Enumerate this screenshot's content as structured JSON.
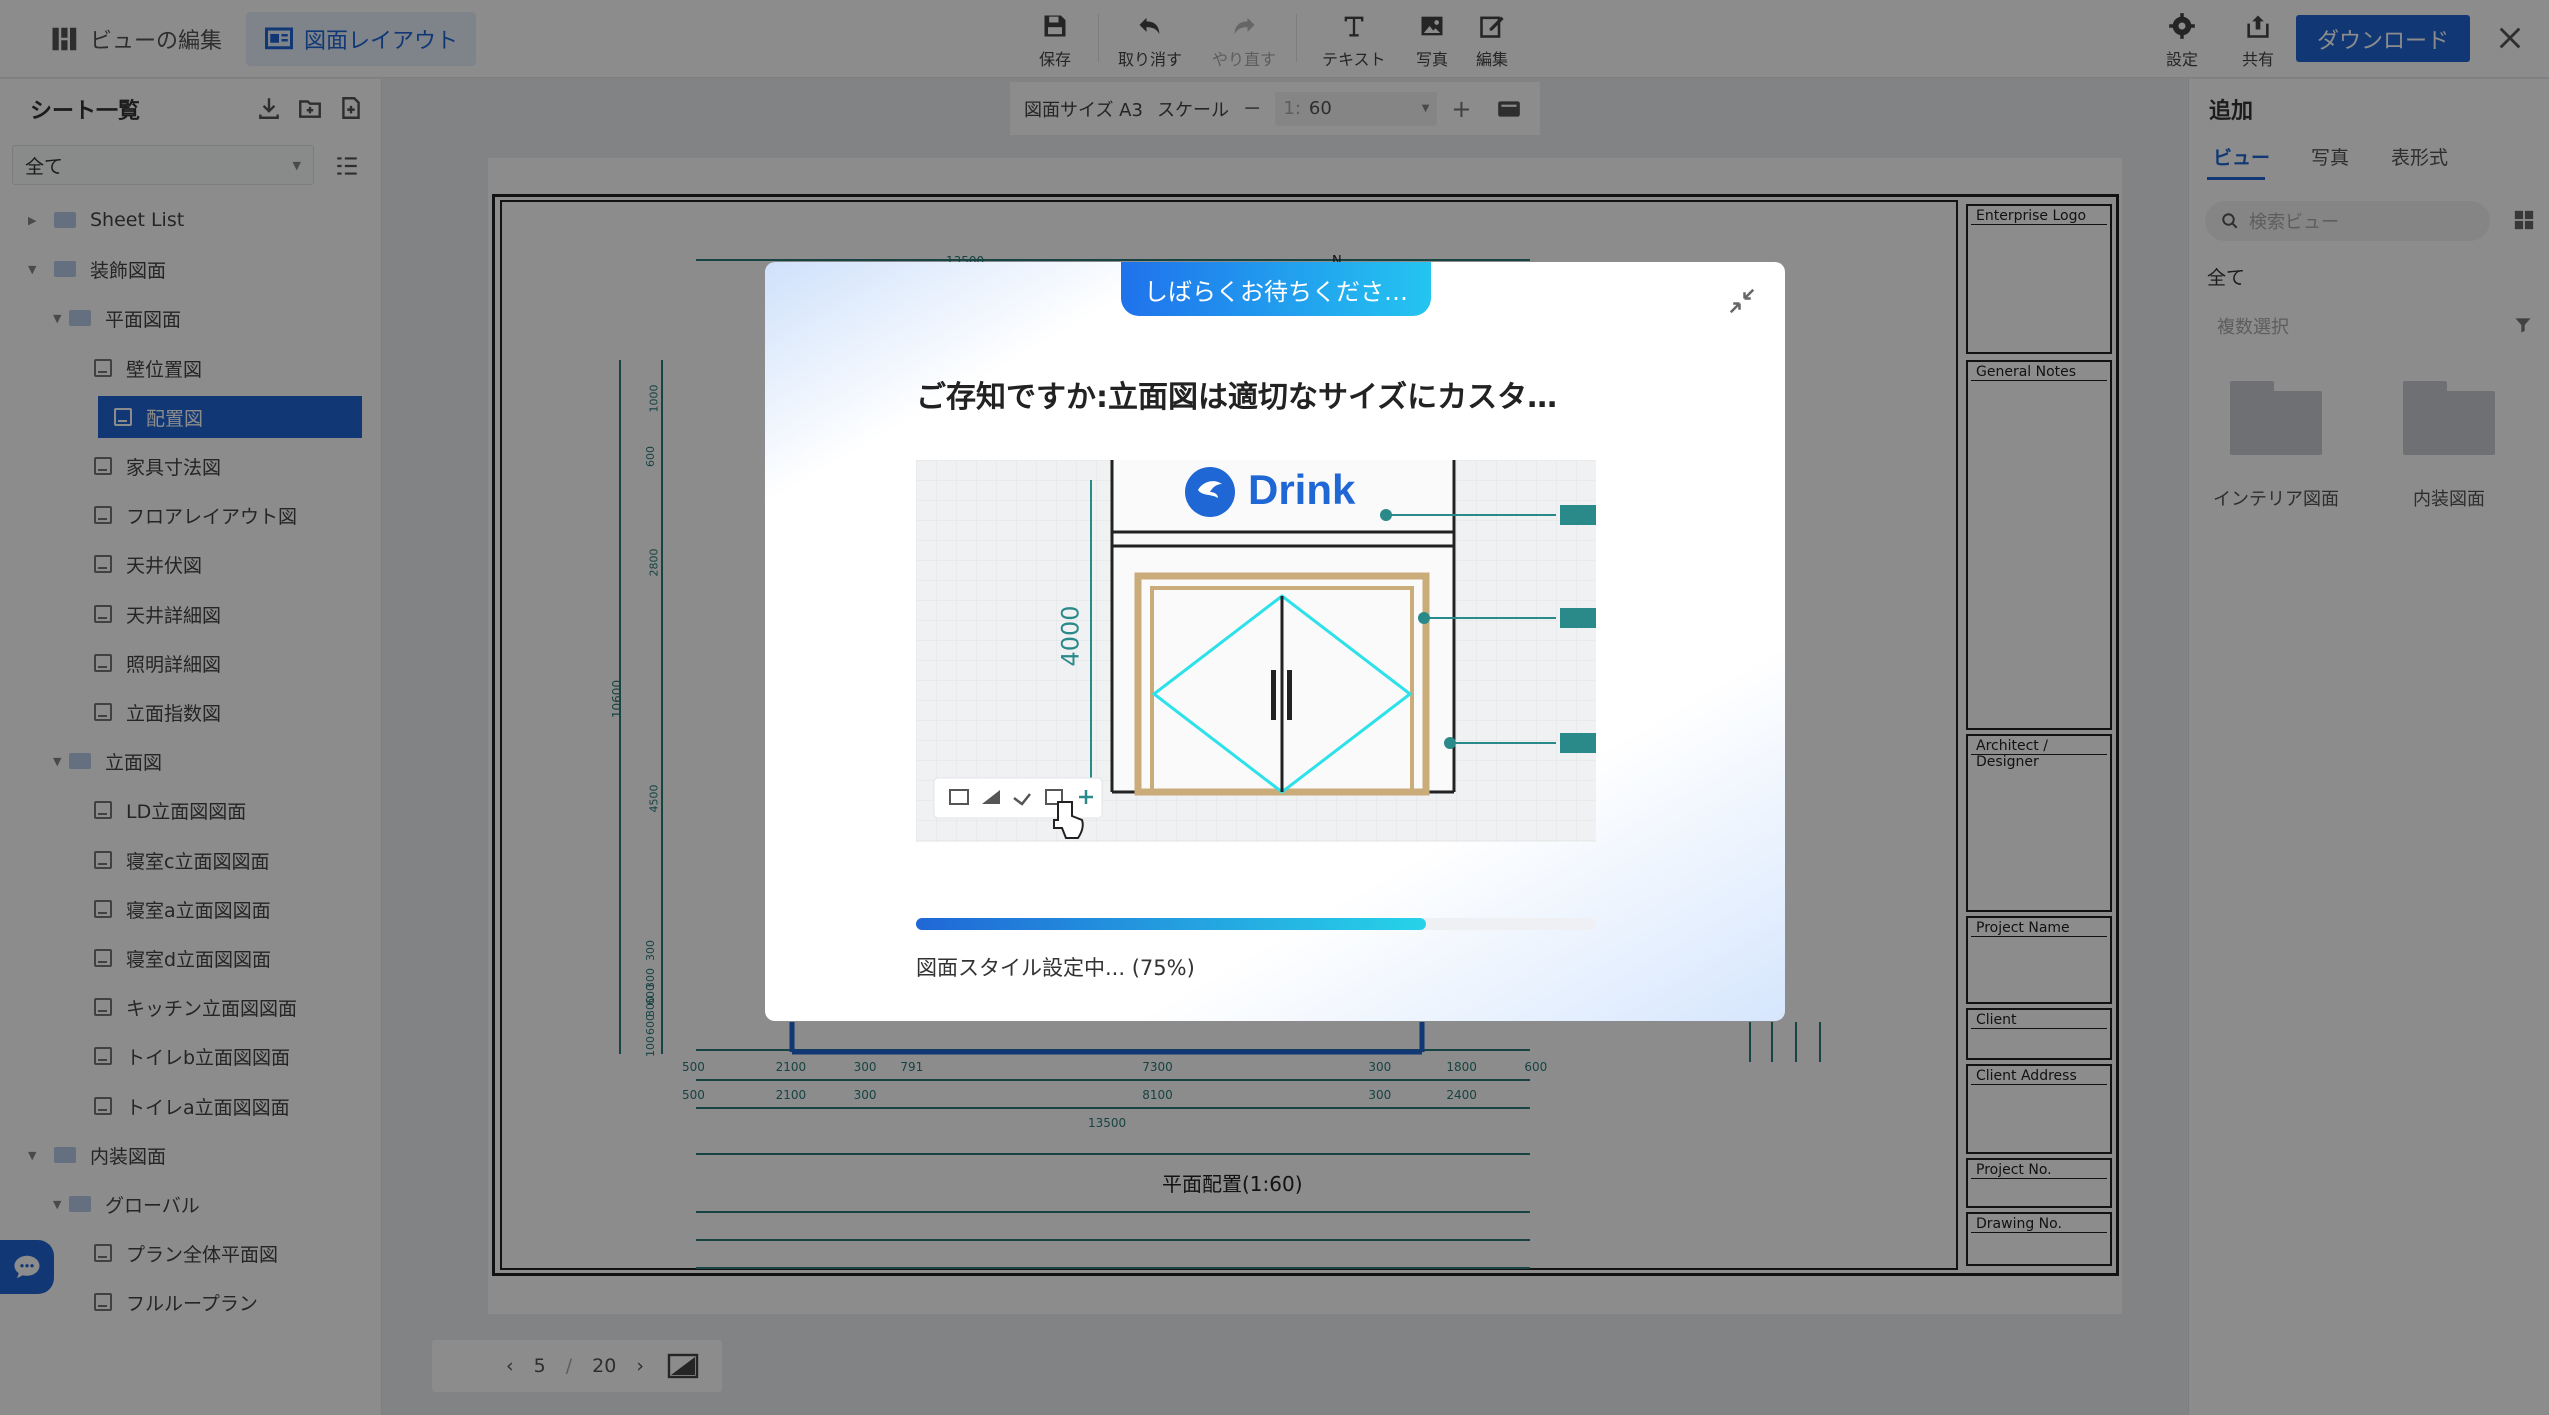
{
  "modes": {
    "view_edit": "ビューの編集",
    "layout": "図面レイアウト"
  },
  "toolbar": {
    "save": "保存",
    "undo": "取り消す",
    "redo": "やり直す",
    "text": "テキスト",
    "photo": "写真",
    "edit": "編集",
    "settings": "設定",
    "share": "共有",
    "download": "ダウンロード"
  },
  "sidebar": {
    "title": "シート一覧",
    "filter": "全て",
    "tree": [
      {
        "label": "Sheet List",
        "kind": "folder",
        "level": 0,
        "expanded": false
      },
      {
        "label": "装飾図面",
        "kind": "folder",
        "level": 0,
        "expanded": true
      },
      {
        "label": "平面図面",
        "kind": "folder",
        "level": 1,
        "expanded": true
      },
      {
        "label": "壁位置図",
        "kind": "sheet",
        "level": 2
      },
      {
        "label": "配置図",
        "kind": "sheet",
        "level": 2,
        "selected": true
      },
      {
        "label": "家具寸法図",
        "kind": "sheet",
        "level": 2
      },
      {
        "label": "フロアレイアウト図",
        "kind": "sheet",
        "level": 2
      },
      {
        "label": "天井伏図",
        "kind": "sheet",
        "level": 2
      },
      {
        "label": "天井詳細図",
        "kind": "sheet",
        "level": 2
      },
      {
        "label": "照明詳細図",
        "kind": "sheet",
        "level": 2
      },
      {
        "label": "立面指数図",
        "kind": "sheet",
        "level": 2
      },
      {
        "label": "立面図",
        "kind": "folder",
        "level": 1,
        "expanded": true
      },
      {
        "label": "LD立面図図面",
        "kind": "sheet",
        "level": 2
      },
      {
        "label": "寝室c立面図図面",
        "kind": "sheet",
        "level": 2
      },
      {
        "label": "寝室a立面図図面",
        "kind": "sheet",
        "level": 2
      },
      {
        "label": "寝室d立面図図面",
        "kind": "sheet",
        "level": 2
      },
      {
        "label": "キッチン立面図図面",
        "kind": "sheet",
        "level": 2
      },
      {
        "label": "トイレb立面図図面",
        "kind": "sheet",
        "level": 2
      },
      {
        "label": "トイレa立面図図面",
        "kind": "sheet",
        "level": 2
      },
      {
        "label": "内装図面",
        "kind": "folder",
        "level": 0,
        "expanded": true
      },
      {
        "label": "グローバル",
        "kind": "folder",
        "level": 1,
        "expanded": true
      },
      {
        "label": "プラン全体平面図",
        "kind": "sheet",
        "level": 2
      },
      {
        "label": "フルループラン",
        "kind": "sheet",
        "level": 2
      }
    ]
  },
  "scalebar": {
    "size_label": "図面サイズ A3",
    "scale_label": "スケール",
    "scale_prefix": "1:",
    "scale_value": "60"
  },
  "sheet": {
    "caption": "平面配置(1:60)",
    "north": "N",
    "top_dim": "13500",
    "left_dims": [
      "1000",
      "600",
      "2800",
      "4500",
      "300",
      "300",
      "600",
      "300",
      "600",
      "100"
    ],
    "left_total": "10600",
    "bottom_row1": [
      "500",
      "2100",
      "300",
      "791",
      "7300",
      "300",
      "1800",
      "600"
    ],
    "bottom_row2": [
      "500",
      "2100",
      "300",
      "8100",
      "300",
      "2400"
    ],
    "bottom_total": "13500",
    "titleblock": [
      "Enterprise Logo",
      "General Notes",
      "Architect / Designer",
      "Project Name",
      "Client",
      "Client Address",
      "Project No.",
      "Drawing No."
    ]
  },
  "rightpanel": {
    "title": "追加",
    "tabs": [
      "ビュー",
      "写真",
      "表形式"
    ],
    "search_placeholder": "検索ビュー",
    "filter_all": "全て",
    "multi_select": "複数選択",
    "folders": [
      "インテリア図面",
      "内装図面"
    ]
  },
  "pager": {
    "current": "5",
    "sep": "/",
    "total": "20"
  },
  "modal": {
    "badge": "しばらくお待ちくださ…",
    "title": "ご存知ですか:立面図は適切なサイズにカスタ…",
    "illus_brand": "Drink",
    "illus_dim": "4000",
    "progress": 0.75,
    "progress_text": "図面スタイル設定中... (75%)"
  },
  "colors": {
    "accent": "#2067d6",
    "teal": "#2a8a89",
    "wood": "#c9ac7a",
    "cyan": "#2ce1ea"
  }
}
